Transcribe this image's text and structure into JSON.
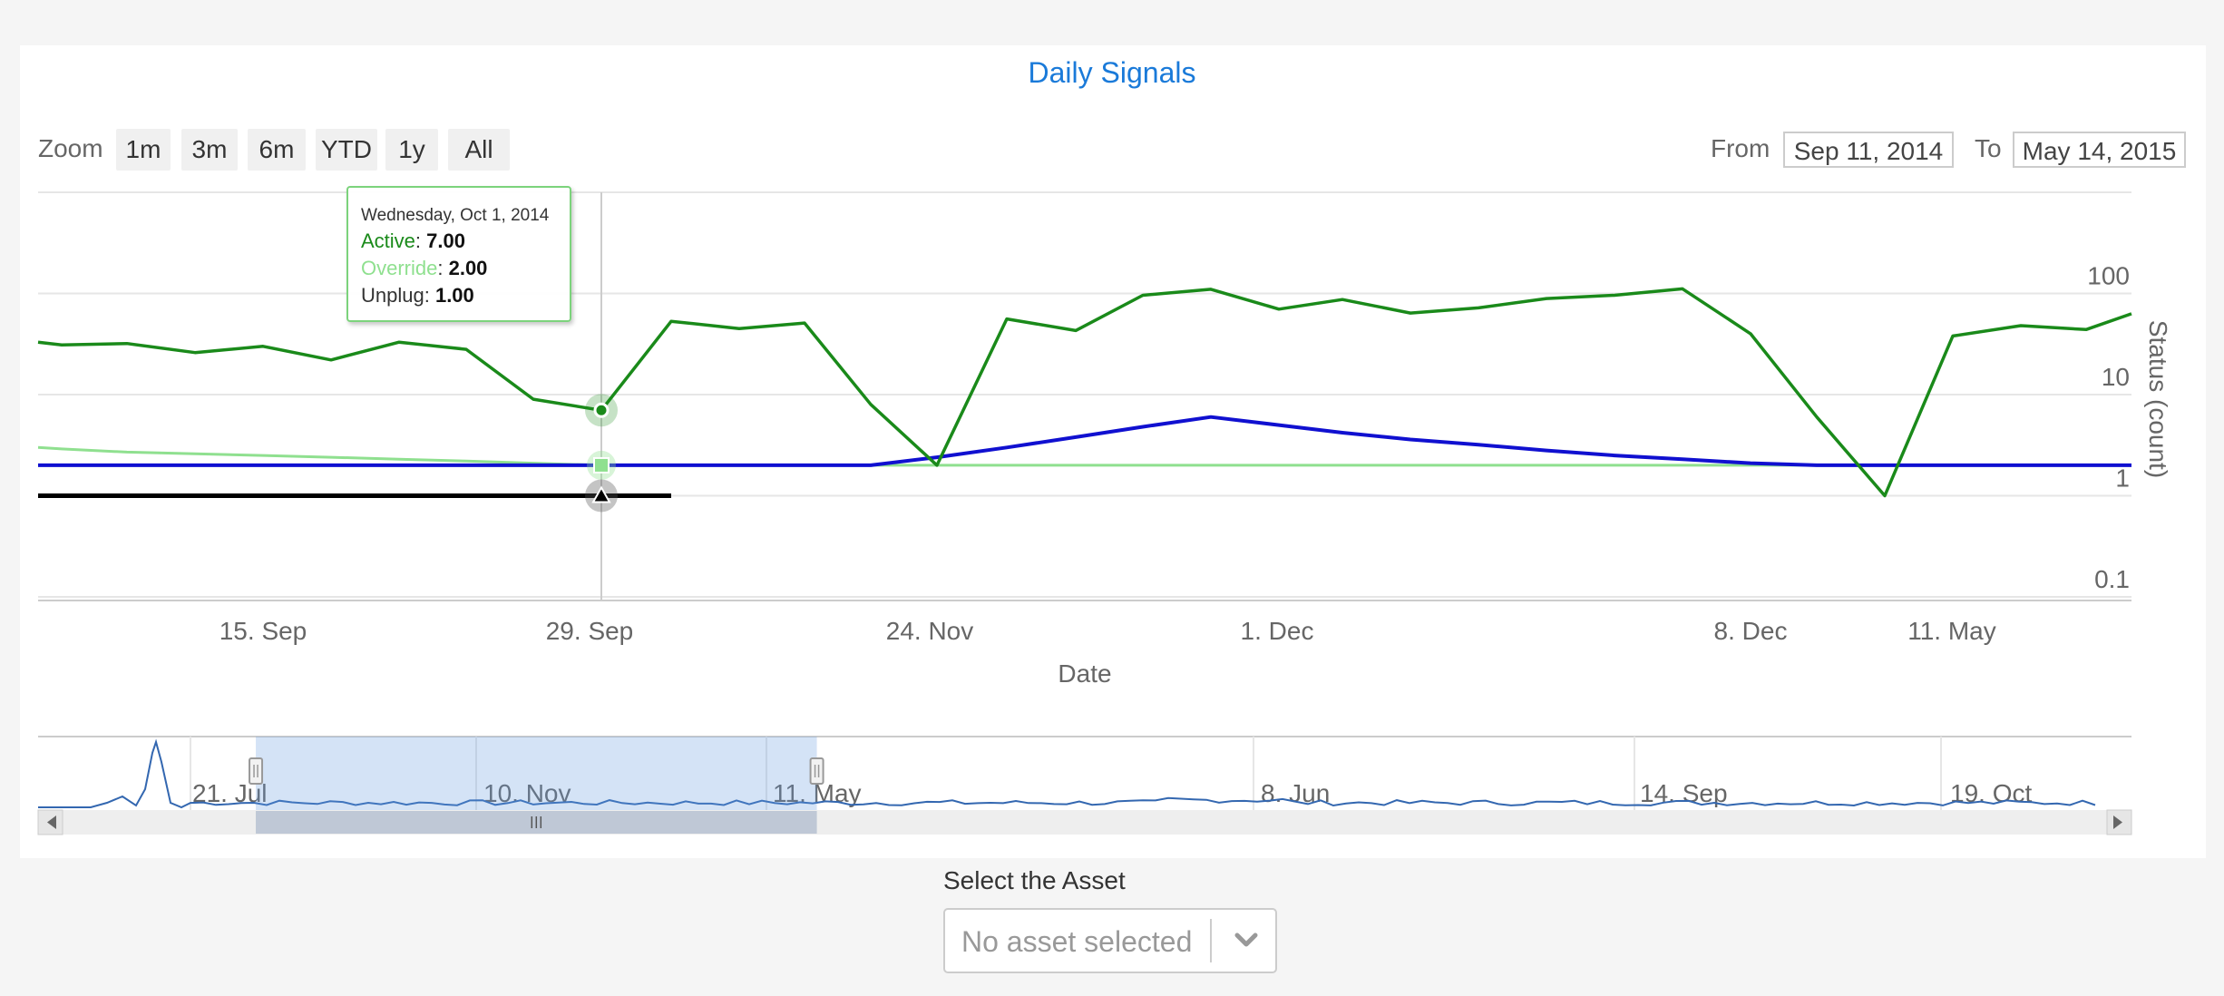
{
  "chart_data": {
    "type": "line",
    "title": "Daily Signals",
    "xlabel": "Date",
    "ylabel": "Status (count)",
    "y_scale": "log",
    "ylim": [
      0.1,
      100
    ],
    "y_ticks": [
      "100",
      "10",
      "1",
      "0.1"
    ],
    "x_ticks": [
      "15. Sep",
      "29. Sep",
      "24. Nov",
      "1. Dec",
      "8. Dec",
      "11. May"
    ],
    "x": [
      "Sep 11",
      "Sep 13",
      "Sep 15",
      "Sep 17",
      "Sep 19",
      "Sep 21",
      "Sep 23",
      "Sep 25",
      "Sep 27",
      "Oct 1",
      "Oct 3",
      "Oct 5",
      "Oct 7",
      "Oct 9",
      "Nov 24",
      "Nov 26",
      "Nov 28",
      "Nov 30",
      "Dec 1",
      "Dec 3",
      "Dec 5",
      "Dec 7",
      "Dec 8",
      "Dec 9",
      "Dec 10",
      "Dec 11",
      "Dec 12",
      "Dec 13",
      "Dec 14",
      "May 11",
      "May 12",
      "May 13",
      "May 14"
    ],
    "series": [
      {
        "name": "Active",
        "color": "#1a8a1a",
        "values": [
          33,
          31,
          32,
          26,
          30,
          22,
          33,
          28,
          9,
          7,
          53,
          45,
          51,
          8,
          2,
          56,
          43,
          96,
          110,
          70,
          87,
          64,
          72,
          89,
          96,
          111,
          40,
          6,
          1,
          38,
          48,
          44,
          63
        ]
      },
      {
        "name": "Override",
        "color": "#8fe08f",
        "values": [
          3,
          2.9,
          2.7,
          2.6,
          2.5,
          2.4,
          2.3,
          2.2,
          2.1,
          2,
          2,
          2,
          2,
          2,
          2,
          2,
          2,
          2,
          2,
          2,
          2,
          2,
          2,
          2,
          2,
          2,
          2,
          2,
          2,
          2,
          2,
          2,
          2
        ]
      },
      {
        "name": "Unplug",
        "color": "#000000",
        "values": [
          1,
          1,
          1,
          1,
          1,
          1,
          1,
          1,
          1,
          1,
          1,
          null,
          null,
          null,
          null,
          null,
          null,
          null,
          null,
          null,
          null,
          null,
          null,
          null,
          null,
          null,
          null,
          null,
          null,
          null,
          null,
          null,
          null
        ]
      },
      {
        "name": "",
        "color": "#1010d0",
        "values": [
          2,
          2,
          2,
          2,
          2,
          2,
          2,
          2,
          2,
          2,
          2,
          2,
          2,
          2,
          2.4,
          3,
          3.8,
          4.8,
          6,
          5,
          4.2,
          3.6,
          3.2,
          2.8,
          2.5,
          2.3,
          2.1,
          2,
          2,
          2,
          2,
          2,
          2
        ]
      }
    ],
    "tooltip": {
      "date": "Wednesday, Oct 1, 2014",
      "rows": [
        {
          "label": "Active",
          "value": "7.00",
          "color": "#1a8a1a"
        },
        {
          "label": "Override",
          "value": "2.00",
          "color": "#8fe08f"
        },
        {
          "label": "Unplug",
          "value": "1.00",
          "color": "#333333"
        }
      ]
    },
    "navigator": {
      "labels": [
        "21. Jul",
        "10. Nov",
        "11. May",
        "8. Jun",
        "14. Sep",
        "19. Oct"
      ],
      "selected_range": [
        0.104,
        0.372
      ]
    }
  },
  "zoom": {
    "label": "Zoom",
    "buttons": [
      "1m",
      "3m",
      "6m",
      "YTD",
      "1y",
      "All"
    ]
  },
  "range": {
    "from_label": "From",
    "from_value": "Sep 11, 2014",
    "to_label": "To",
    "to_value": "May 14, 2015"
  },
  "asset": {
    "label": "Select the Asset",
    "placeholder": "No asset selected"
  }
}
